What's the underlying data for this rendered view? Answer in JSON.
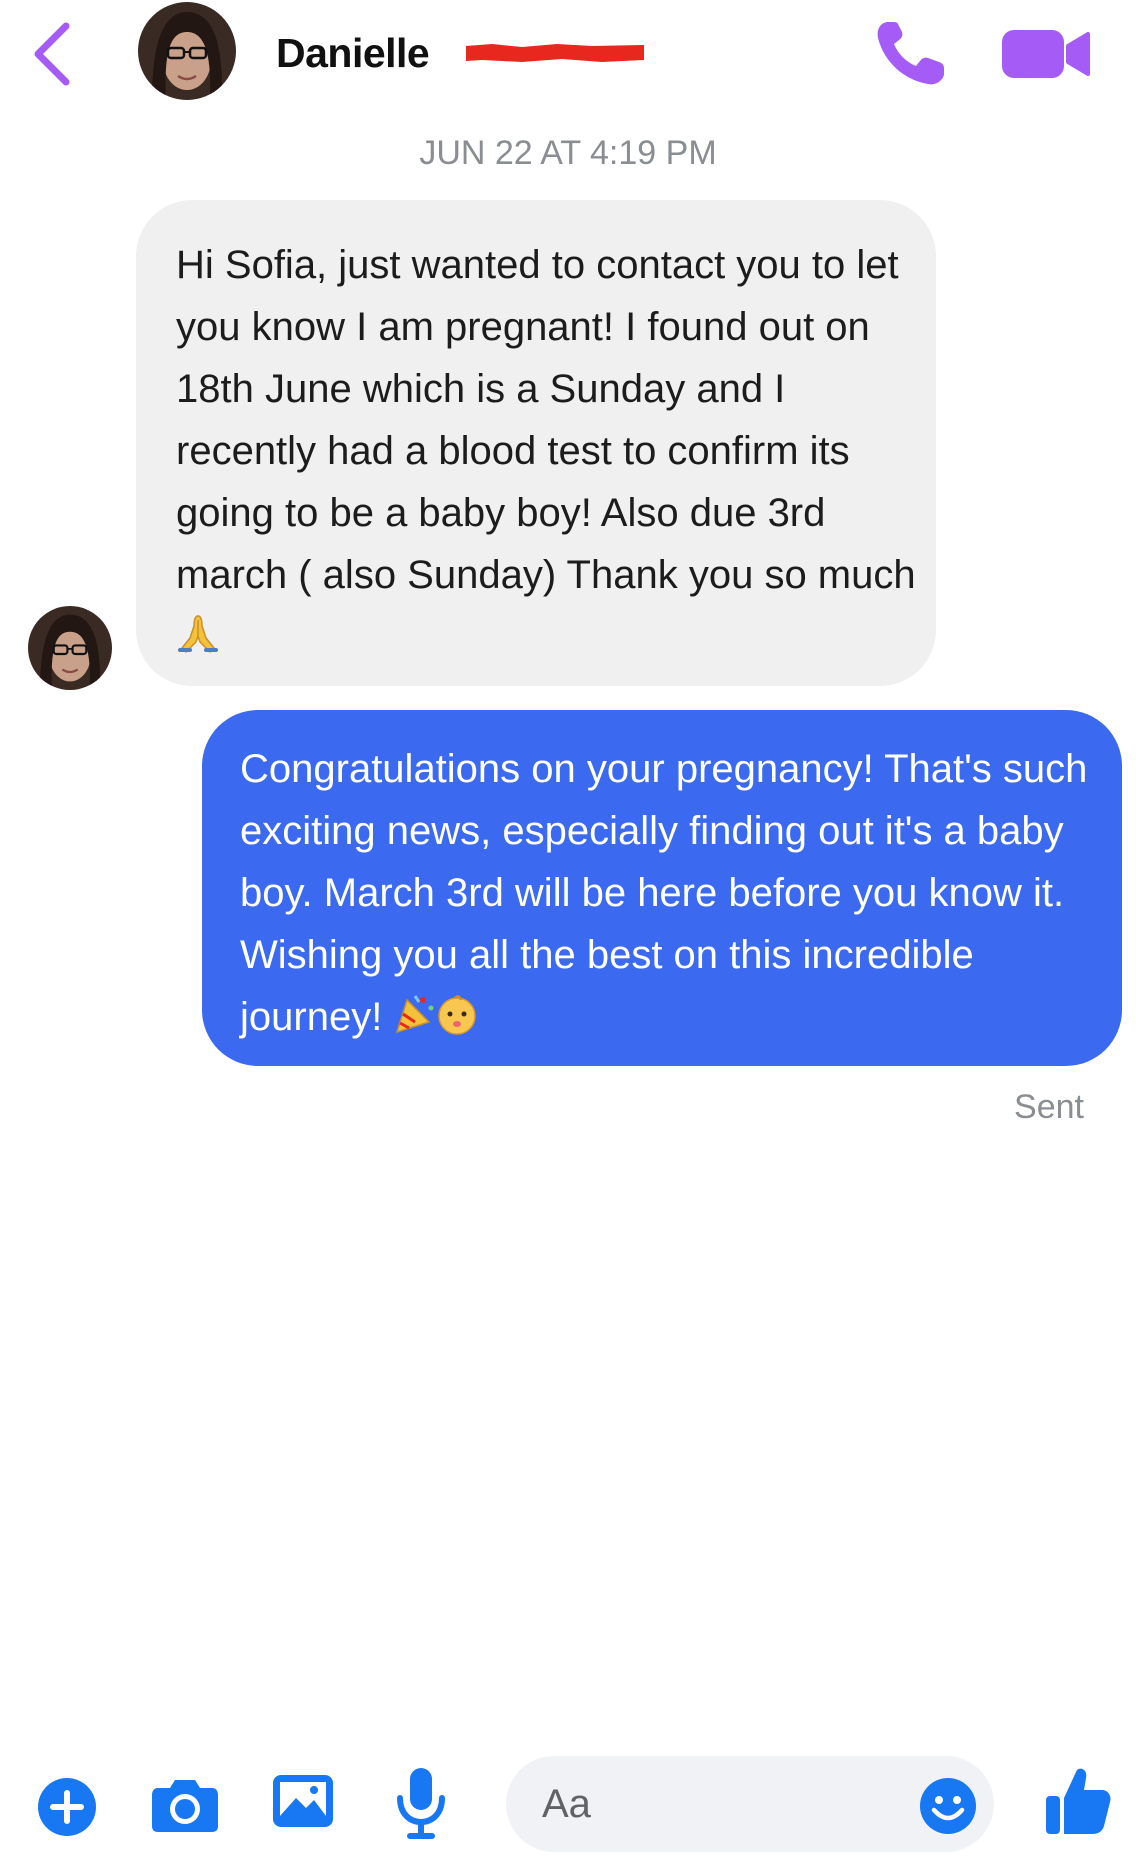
{
  "header": {
    "contact_first_name": "Danielle",
    "back_icon": "chevron-left-icon",
    "call_icon": "phone-icon",
    "video_icon": "video-camera-icon"
  },
  "thread": {
    "timestamp": "JUN 22 AT 4:19 PM",
    "incoming_message": "Hi Sofia, just wanted to contact you to let you know I am pregnant! I found out on 18th June which is a Sunday and I recently had a blood test to confirm its going to be a baby boy! Also due 3rd march ( also Sunday) Thank you so much",
    "incoming_emoji": "folded-hands-emoji",
    "outgoing_message": "Congratulations on your pregnancy! That's such exciting news, especially finding out it's a baby boy. March 3rd will be here before you know it. Wishing you all the best on this incredible journey!",
    "outgoing_emojis": [
      "party-popper-emoji",
      "baby-emoji"
    ],
    "sent_status": "Sent"
  },
  "composer": {
    "placeholder": "Aa",
    "icons": [
      "plus-icon",
      "camera-icon",
      "image-icon",
      "microphone-icon",
      "emoji-icon",
      "thumbs-up-icon"
    ]
  },
  "colors": {
    "accent_purple": "#a55bf5",
    "outgoing_bubble": "#3b6af0",
    "incoming_bubble": "#f0f0f0",
    "toolbar_blue": "#1877f2",
    "meta_gray": "#8a8d91"
  }
}
